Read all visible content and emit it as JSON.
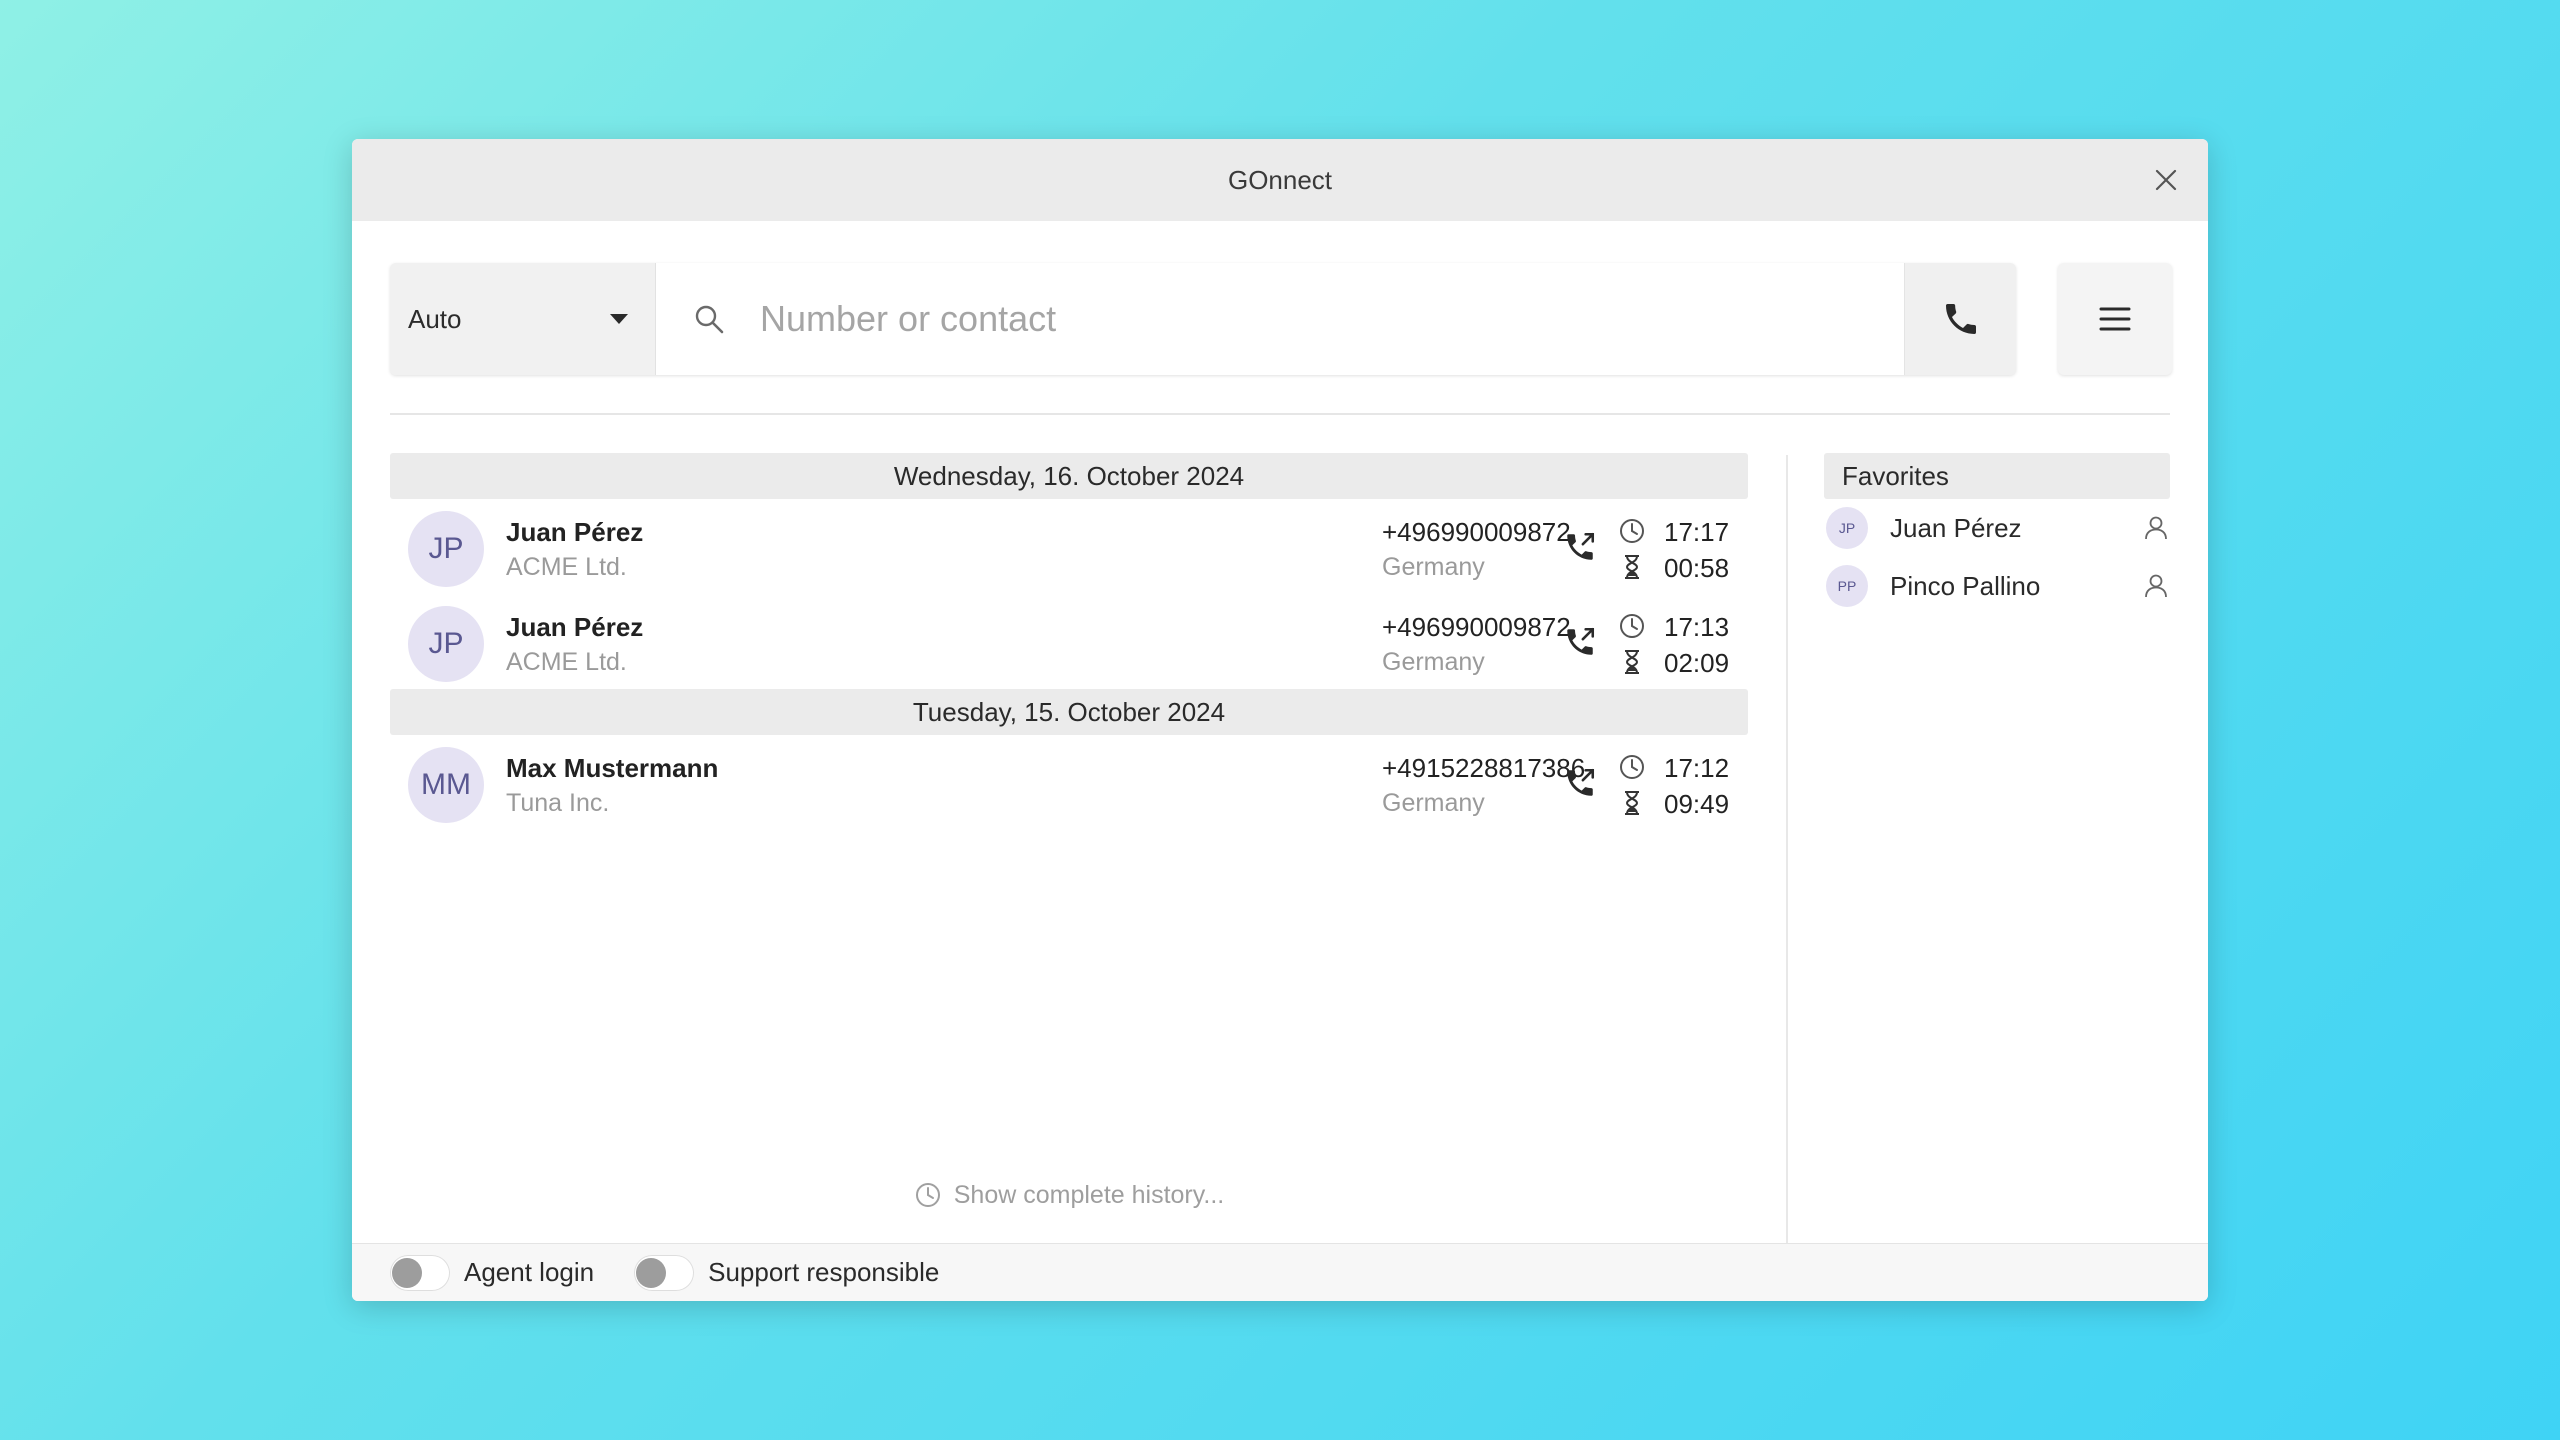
{
  "window": {
    "title": "GOnnect",
    "close_icon": "close-icon"
  },
  "toolbar": {
    "mode": "Auto",
    "search_placeholder": "Number or contact",
    "search_value": "",
    "call_icon": "phone-icon",
    "menu_icon": "hamburger-menu-icon"
  },
  "history": {
    "groups": [
      {
        "date": "Wednesday, 16. October 2024",
        "calls": [
          {
            "initials": "JP",
            "name": "Juan Pérez",
            "company": "ACME Ltd.",
            "number": "+496990009872",
            "country": "Germany",
            "time": "17:17",
            "duration": "00:58",
            "type_icon": "outgoing-call-icon"
          },
          {
            "initials": "JP",
            "name": "Juan Pérez",
            "company": "ACME Ltd.",
            "number": "+496990009872",
            "country": "Germany",
            "time": "17:13",
            "duration": "02:09",
            "type_icon": "outgoing-call-icon"
          }
        ]
      },
      {
        "date": "Tuesday, 15. October 2024",
        "calls": [
          {
            "initials": "MM",
            "name": "Max Mustermann",
            "company": "Tuna Inc.",
            "number": "+4915228817386",
            "country": "Germany",
            "time": "17:12",
            "duration": "09:49",
            "type_icon": "outgoing-call-icon"
          }
        ]
      }
    ],
    "show_complete": "Show complete history..."
  },
  "favorites": {
    "header": "Favorites",
    "items": [
      {
        "initials": "JP",
        "name": "Juan Pérez"
      },
      {
        "initials": "PP",
        "name": "Pinco Pallino"
      }
    ]
  },
  "footer": {
    "toggles": [
      {
        "label": "Agent login",
        "on": false
      },
      {
        "label": "Support responsible",
        "on": false
      }
    ]
  },
  "colors": {
    "avatar_bg": "#e5e2f3",
    "avatar_text": "#5a5891",
    "toggle_knob_off": "#9d9d9d"
  }
}
